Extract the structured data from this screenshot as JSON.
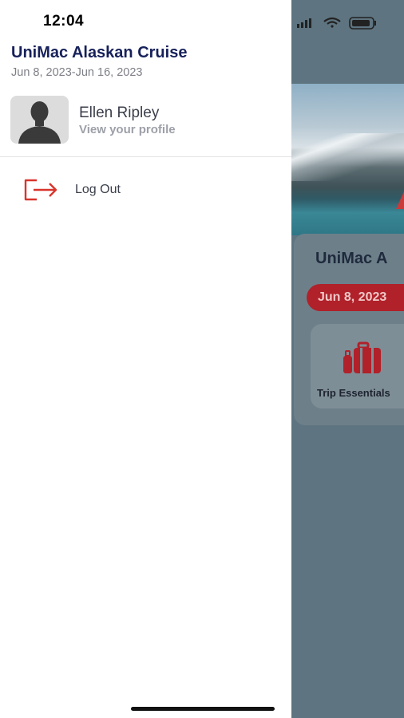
{
  "status_bar": {
    "time": "12:04",
    "icons": [
      "signal-icon",
      "wifi-icon",
      "battery-icon"
    ]
  },
  "drawer": {
    "trip_name": "UniMac Alaskan Cruise",
    "trip_dates": "Jun 8, 2023-Jun 16, 2023",
    "profile": {
      "name": "Ellen Ripley",
      "link_label": "View your profile",
      "avatar_icon": "person-silhouette-icon"
    },
    "logout": {
      "label": "Log Out",
      "icon": "logout-icon"
    }
  },
  "background_app": {
    "trip_title": "UniMac A",
    "date_pill": "Jun 8, 2023",
    "tile_label": "Trip Essentials",
    "tile_icon": "luggage-icon"
  },
  "colors": {
    "brand_navy": "#17215a",
    "accent_red": "#d8342c",
    "overlay": "#5e7480"
  }
}
